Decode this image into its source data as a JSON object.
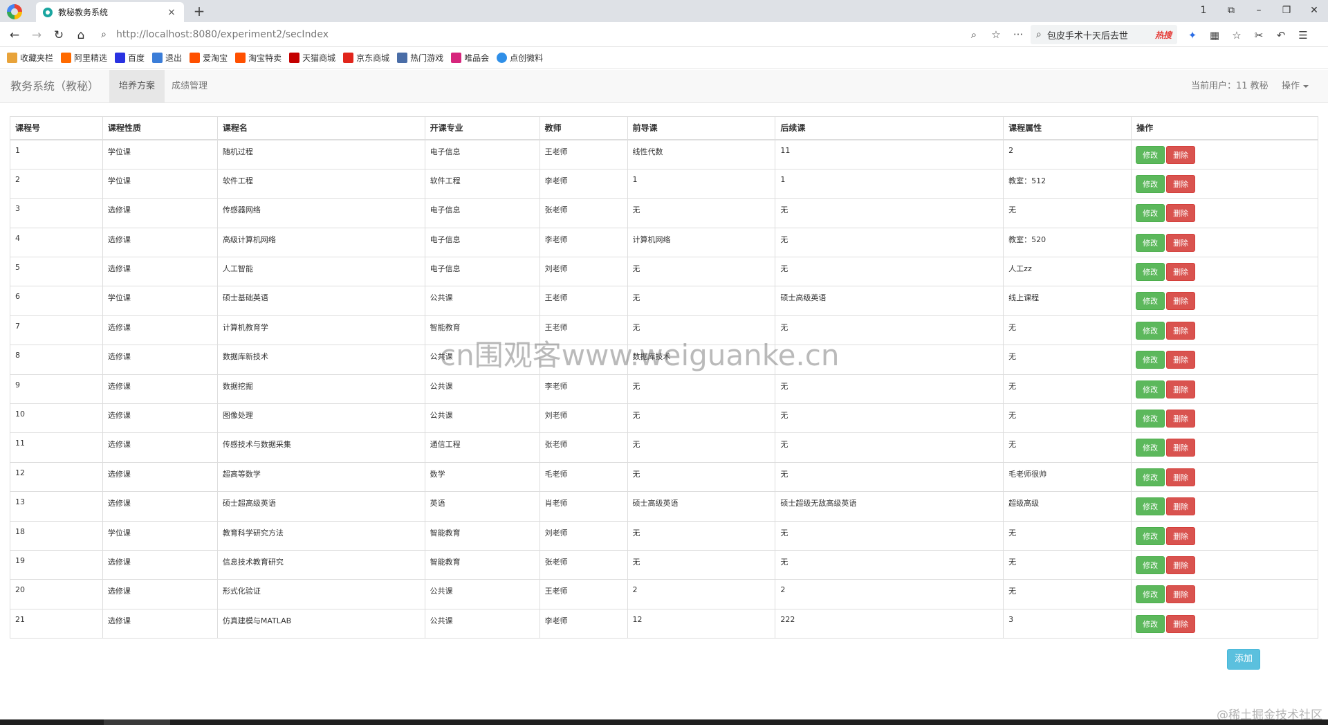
{
  "browser": {
    "tab_title": "教秘教务系统",
    "tab_close": "×",
    "new_tab": "+",
    "url": "http://localhost:8080/experiment2/secIndex",
    "search_text": "包皮手术十天后去世",
    "hot_label": "热搜",
    "win_controls": [
      "1",
      "⧉",
      "–",
      "❐",
      "✕"
    ],
    "bookmarks": [
      {
        "label": "收藏夹栏",
        "icon": "folder-icon",
        "color": "#e8a33a"
      },
      {
        "label": "阿里精选",
        "icon": "ali-icon",
        "color": "#ff6a00"
      },
      {
        "label": "百度",
        "icon": "baidu-icon",
        "color": "#2932e1"
      },
      {
        "label": "退出",
        "icon": "feather-icon",
        "color": "#3b7dd8"
      },
      {
        "label": "爱淘宝",
        "icon": "taobao-icon",
        "color": "#ff5000"
      },
      {
        "label": "淘宝特卖",
        "icon": "taobao-icon",
        "color": "#ff5000"
      },
      {
        "label": "天猫商城",
        "icon": "tmall-icon",
        "color": "#c40000"
      },
      {
        "label": "京东商城",
        "icon": "jd-icon",
        "color": "#e1251b"
      },
      {
        "label": "热门游戏",
        "icon": "game-icon",
        "color": "#4a6da7"
      },
      {
        "label": "唯品会",
        "icon": "vip-icon",
        "color": "#d6257c"
      },
      {
        "label": "点创微料",
        "icon": "dot-icon",
        "color": "#2f8fe8"
      }
    ]
  },
  "app": {
    "brand": "教务系统（教秘）",
    "nav": [
      "培养方案",
      "成绩管理"
    ],
    "current_user": "当前用户：11 教秘",
    "ops_menu": "操作"
  },
  "table": {
    "headers": [
      "课程号",
      "课程性质",
      "课程名",
      "开课专业",
      "教师",
      "前导课",
      "后续课",
      "课程属性",
      "操作"
    ],
    "edit_label": "修改",
    "delete_label": "删除",
    "rows": [
      [
        "1",
        "学位课",
        "随机过程",
        "电子信息",
        "王老师",
        "线性代数",
        "11",
        "2"
      ],
      [
        "2",
        "学位课",
        "软件工程",
        "软件工程",
        "李老师",
        "1",
        "1",
        "教室：512"
      ],
      [
        "3",
        "选修课",
        "传感器网络",
        "电子信息",
        "张老师",
        "无",
        "无",
        "无"
      ],
      [
        "4",
        "选修课",
        "高级计算机网络",
        "电子信息",
        "李老师",
        "计算机网络",
        "无",
        "教室：520"
      ],
      [
        "5",
        "选修课",
        "人工智能",
        "电子信息",
        "刘老师",
        "无",
        "无",
        "人工zz"
      ],
      [
        "6",
        "学位课",
        "硕士基础英语",
        "公共课",
        "王老师",
        "无",
        "硕士高级英语",
        "线上课程"
      ],
      [
        "7",
        "选修课",
        "计算机教育学",
        "智能教育",
        "王老师",
        "无",
        "无",
        "无"
      ],
      [
        "8",
        "选修课",
        "数据库新技术",
        "公共课",
        "",
        "数据库技术",
        "",
        "无"
      ],
      [
        "9",
        "选修课",
        "数据挖掘",
        "公共课",
        "李老师",
        "无",
        "无",
        "无"
      ],
      [
        "10",
        "选修课",
        "图像处理",
        "公共课",
        "刘老师",
        "无",
        "无",
        "无"
      ],
      [
        "11",
        "选修课",
        "传感技术与数据采集",
        "通信工程",
        "张老师",
        "无",
        "无",
        "无"
      ],
      [
        "12",
        "选修课",
        "超高等数学",
        "数学",
        "毛老师",
        "无",
        "无",
        "毛老师很帅"
      ],
      [
        "13",
        "选修课",
        "硕士超高级英语",
        "英语",
        "肖老师",
        "硕士高级英语",
        "硕士超级无敌高级英语",
        "超级高级"
      ],
      [
        "18",
        "学位课",
        "教育科学研究方法",
        "智能教育",
        "刘老师",
        "无",
        "无",
        "无"
      ],
      [
        "19",
        "选修课",
        "信息技术教育研究",
        "智能教育",
        "张老师",
        "无",
        "无",
        "无"
      ],
      [
        "20",
        "选修课",
        "形式化验证",
        "公共课",
        "王老师",
        "2",
        "2",
        "无"
      ],
      [
        "21",
        "选修课",
        "仿真建模与MATLAB",
        "公共课",
        "李老师",
        "12",
        "222",
        "3"
      ]
    ]
  },
  "add_label": "添加",
  "watermark": "cn围观客www.weiguanke.cn",
  "corner_mark": "@稀土掘金技术社区"
}
